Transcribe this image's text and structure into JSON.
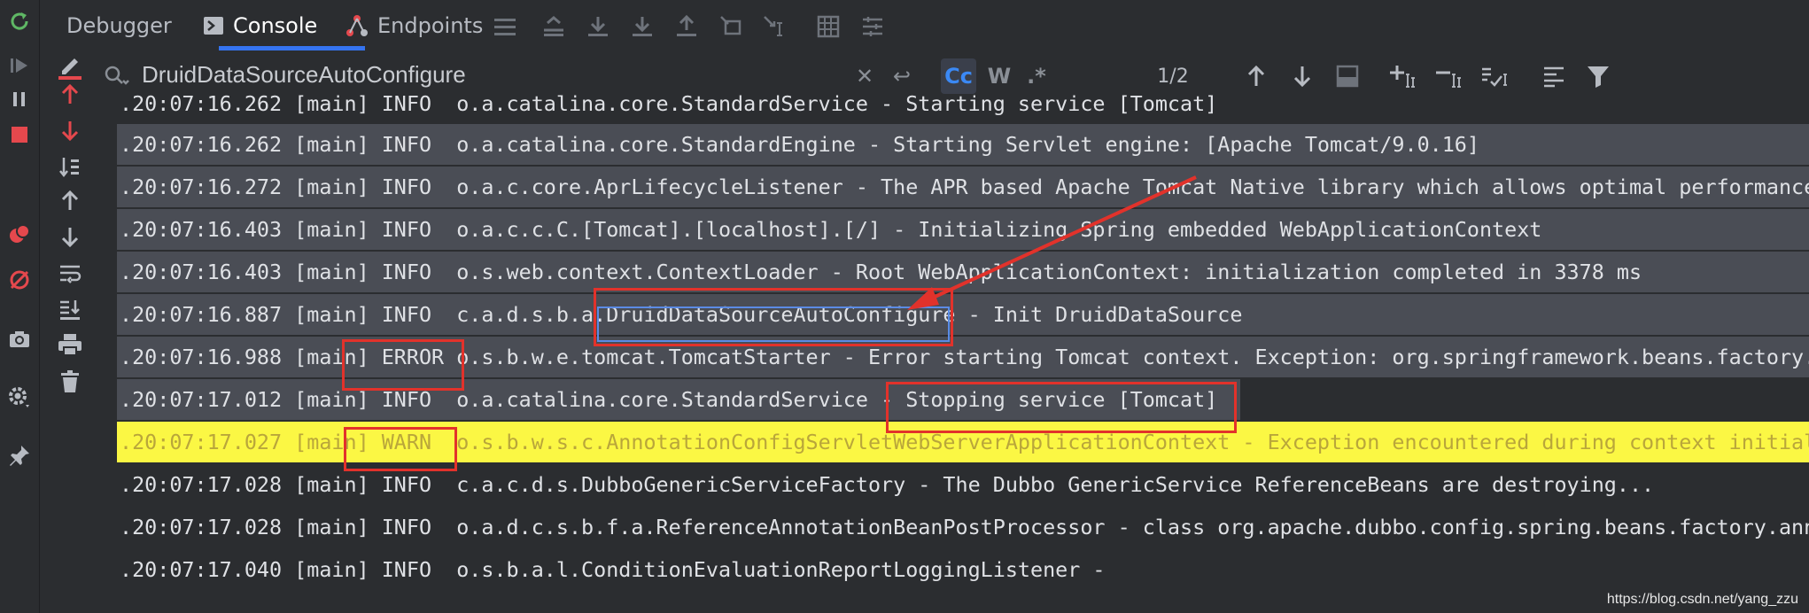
{
  "tabs": [
    {
      "label": "Debugger"
    },
    {
      "label": "Console"
    },
    {
      "label": "Endpoints"
    }
  ],
  "search": {
    "query": "DruidDataSourceAutoConfigure",
    "match_case_label": "Cc",
    "words_label": "W",
    "regex_label": ".*",
    "match_count": "1/2"
  },
  "log_lines": [
    ".20:07:16.262 [main] INFO  o.a.catalina.core.StandardService - Starting service [Tomcat]",
    ".20:07:16.262 [main] INFO  o.a.catalina.core.StandardEngine - Starting Servlet engine: [Apache Tomcat/9.0.16]",
    ".20:07:16.272 [main] INFO  o.a.c.core.AprLifecycleListener - The APR based Apache Tomcat Native library which allows optimal performance",
    ".20:07:16.403 [main] INFO  o.a.c.c.C.[Tomcat].[localhost].[/] - Initializing Spring embedded WebApplicationContext",
    ".20:07:16.403 [main] INFO  o.s.web.context.ContextLoader - Root WebApplicationContext: initialization completed in 3378 ms",
    ".20:07:16.887 [main] INFO  c.a.d.s.b.a.DruidDataSourceAutoConfigure - Init DruidDataSource",
    ".20:07:16.988 [main] ERROR o.s.b.w.e.tomcat.TomcatStarter - Error starting Tomcat context. Exception: org.springframework.beans.factory.B",
    ".20:07:17.012 [main] INFO  o.a.catalina.core.StandardService - Stopping service [Tomcat]",
    ".20:07:17.027 [main] WARN  o.s.b.w.s.c.AnnotationConfigServletWebServerApplicationContext - Exception encountered during context initiali",
    ".20:07:17.028 [main] INFO  c.a.c.d.s.DubboGenericServiceFactory - The Dubbo GenericService ReferenceBeans are destroying...",
    ".20:07:17.028 [main] INFO  o.a.d.c.s.b.f.a.ReferenceAnnotationBeanPostProcessor - class org.apache.dubbo.config.spring.beans.factory.anno",
    ".20:07:17.040 [main] INFO  o.s.b.a.l.ConditionEvaluationReportLoggingListener -"
  ],
  "watermark": "https://blog.csdn.net/yang_zzu",
  "colors": {
    "background": "#2b2d30",
    "highlight_row": "#4a4d55",
    "warn_row": "#fbf744",
    "annotation_red": "#e2322b",
    "accent": "#3574f0"
  }
}
